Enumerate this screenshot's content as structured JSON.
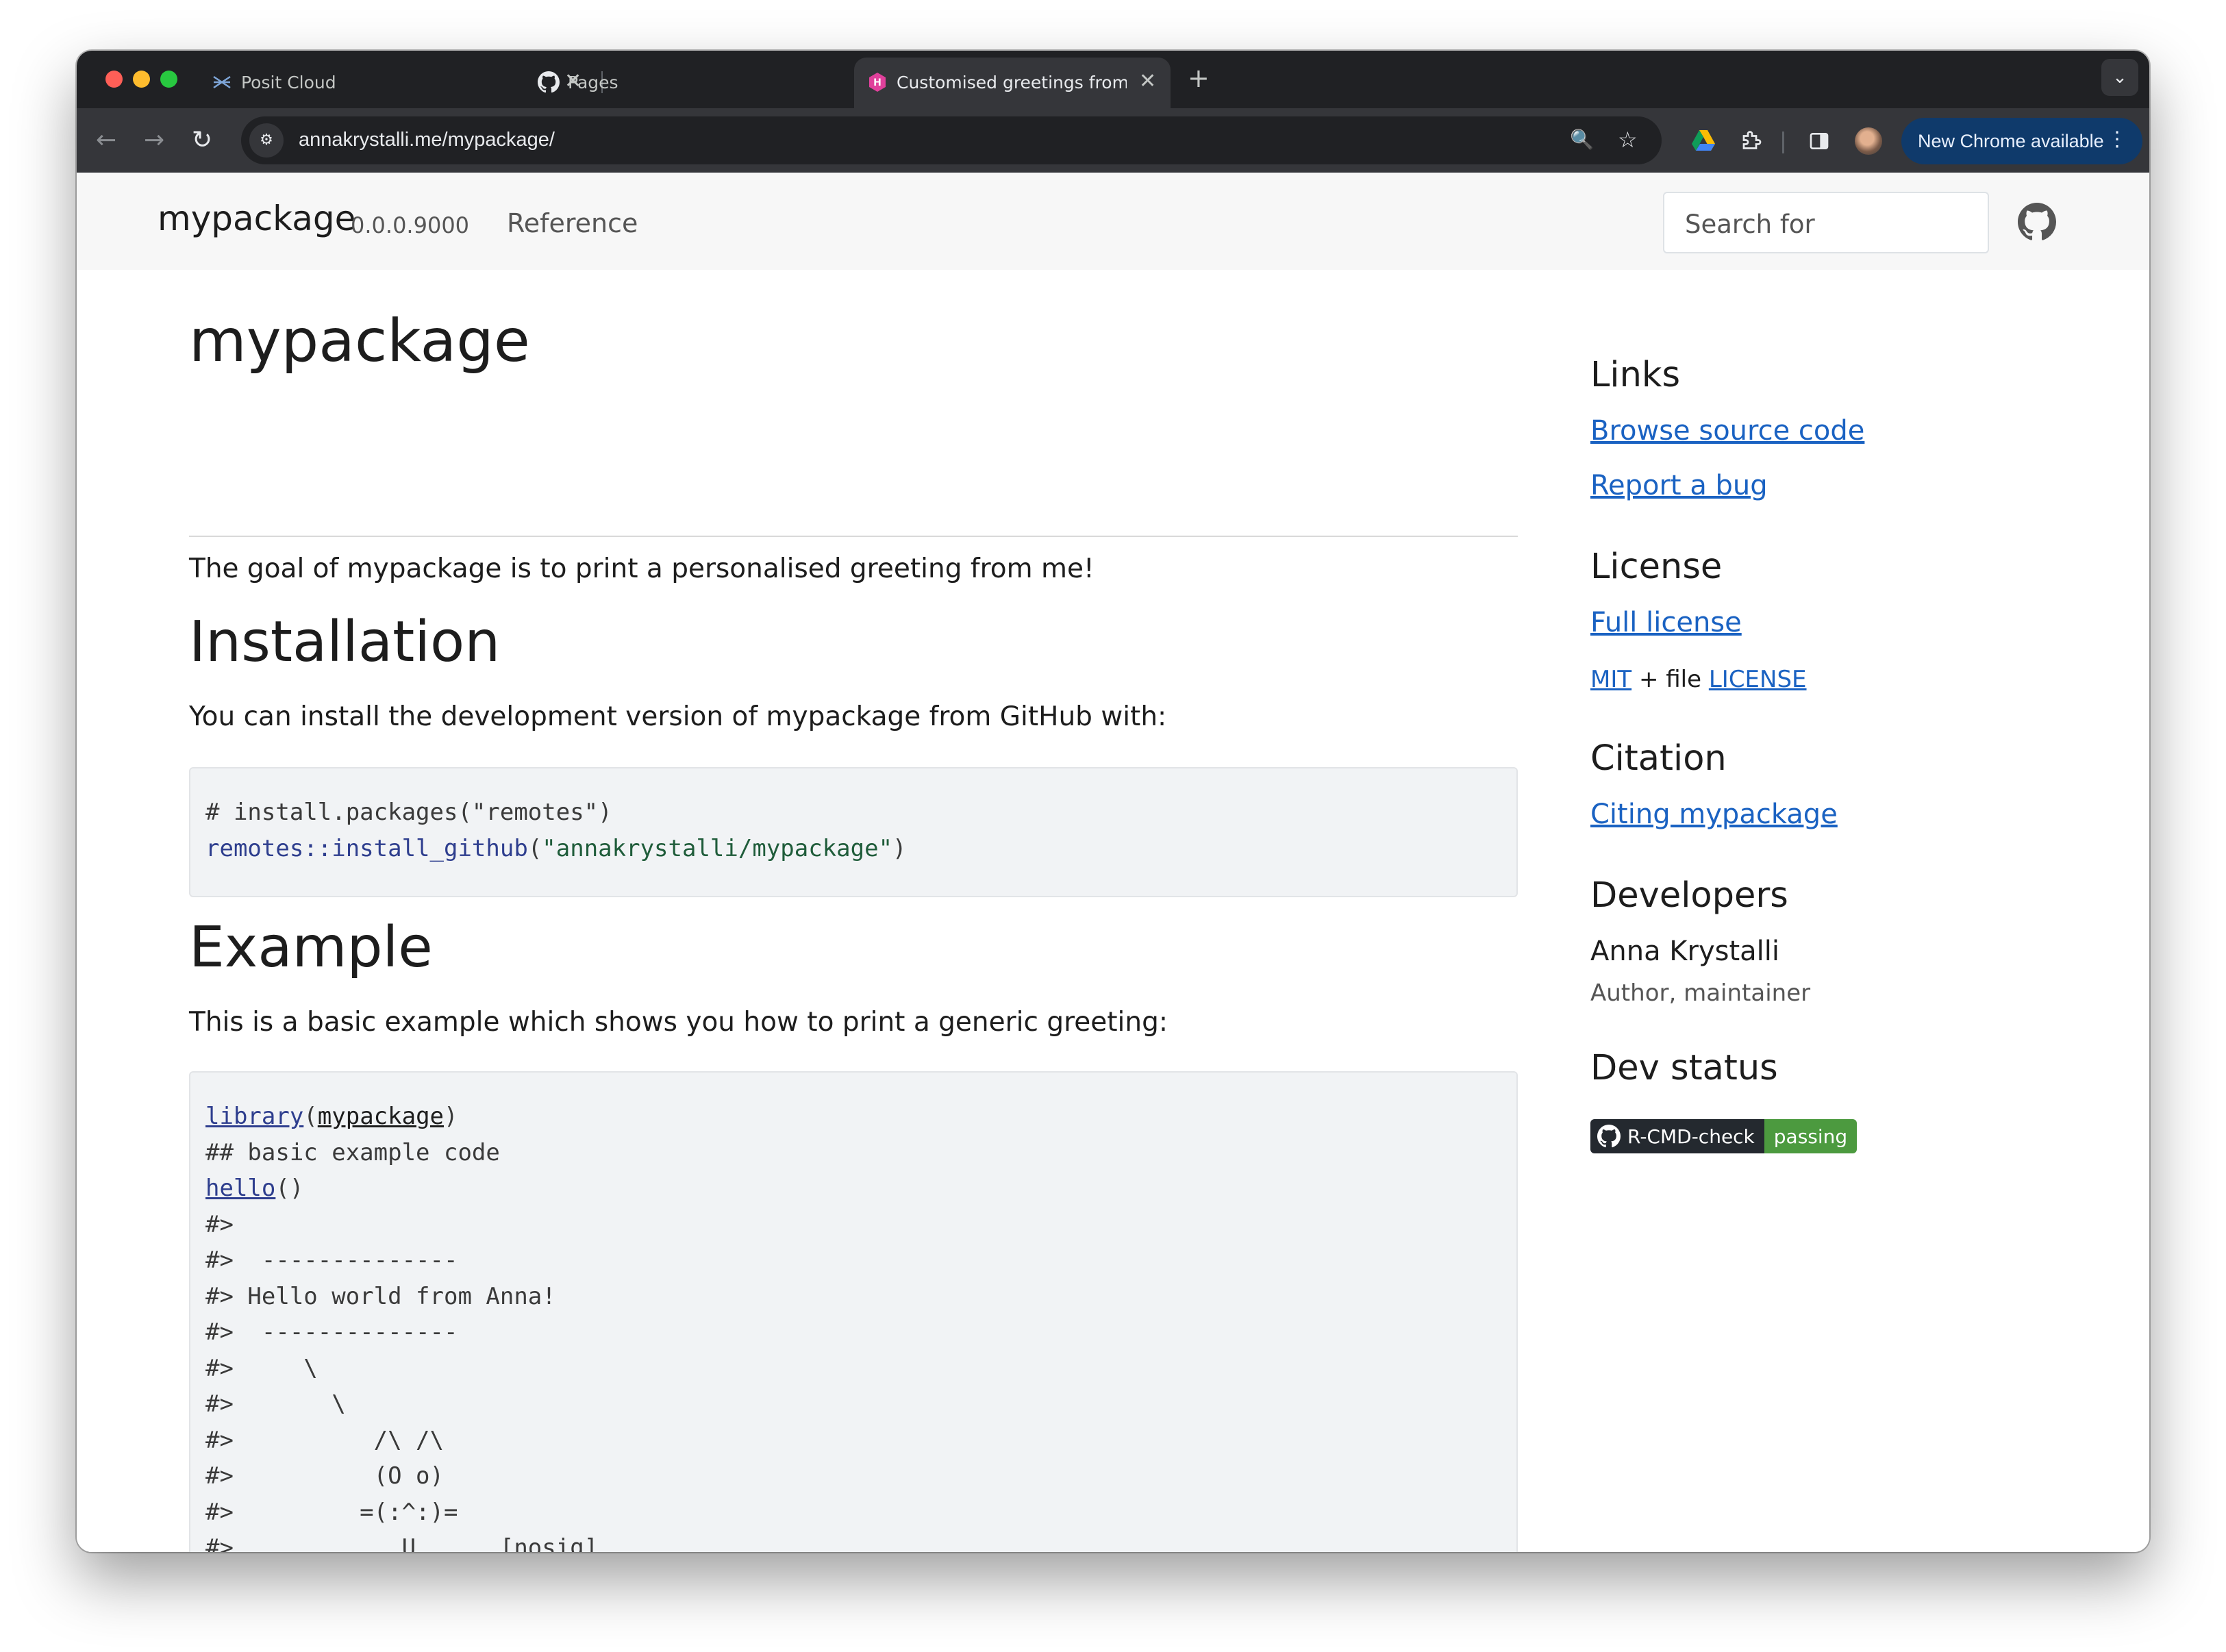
{
  "browser": {
    "tabs": [
      {
        "title": "Posit Cloud",
        "icon": "posit-cloud-icon"
      },
      {
        "title": "Pages",
        "icon": "github-icon"
      },
      {
        "title": "Customised greetings from m",
        "icon": "pkgdown-site-icon"
      }
    ],
    "new_tab_glyph": "+",
    "tab_search_glyph": "⌄",
    "close_glyph": "✕",
    "url_domain": "annakrystalli.me",
    "url_path": "/mypackage/",
    "update_button": "New Chrome available",
    "update_menu_glyph": "⋮",
    "back_glyph": "←",
    "forward_glyph": "→",
    "reload_glyph": "↻",
    "zoom_glyph": "🔍",
    "star_glyph": "☆",
    "site_info_glyph": "⚙"
  },
  "navbar": {
    "brand": "mypackage",
    "version": "0.0.0.9000",
    "reference": "Reference",
    "search_placeholder": "Search for"
  },
  "main": {
    "title": "mypackage",
    "intro": "The goal of mypackage is to print a personalised greeting from me!",
    "installation_heading": "Installation",
    "installation_text": "You can install the development version of mypackage from GitHub with:",
    "install_code": {
      "line1": "# install.packages(\"remotes\")",
      "fn": "remotes::install_github",
      "paren_open": "(",
      "arg": "\"annakrystalli/mypackage\"",
      "paren_close": ")"
    },
    "example_heading": "Example",
    "example_text": "This is a basic example which shows you how to print a generic greeting:",
    "example_code": {
      "library_fn": "library",
      "pkg": "mypackage",
      "open": "(",
      "close": ")",
      "comment": "## basic example code",
      "hello_fn": "hello",
      "call_parens": "()",
      "output": [
        "#>",
        "#>  --------------",
        "#> Hello world from Anna!",
        "#>  --------------",
        "#>     \\",
        "#>       \\",
        "#>          /\\ /\\",
        "#>          (O o)",
        "#>         =(:^:)=",
        "#>            U      [nosig]",
        "#>"
      ]
    }
  },
  "sidebar": {
    "links_heading": "Links",
    "browse_source": "Browse source code",
    "report_bug": "Report a bug",
    "license_heading": "License",
    "full_license": "Full license",
    "mit": "MIT",
    "plus_file": " + file ",
    "license_file": "LICENSE",
    "citation_heading": "Citation",
    "citing": "Citing mypackage",
    "developers_heading": "Developers",
    "developer_name": "Anna Krystalli",
    "developer_role": "Author, maintainer",
    "dev_status_heading": "Dev status",
    "badge_label": "R-CMD-check",
    "badge_status": "passing"
  },
  "colors": {
    "link": "#1a62c2",
    "badge_pass": "#4c9a3f",
    "update_button": "#0f3a6b"
  }
}
